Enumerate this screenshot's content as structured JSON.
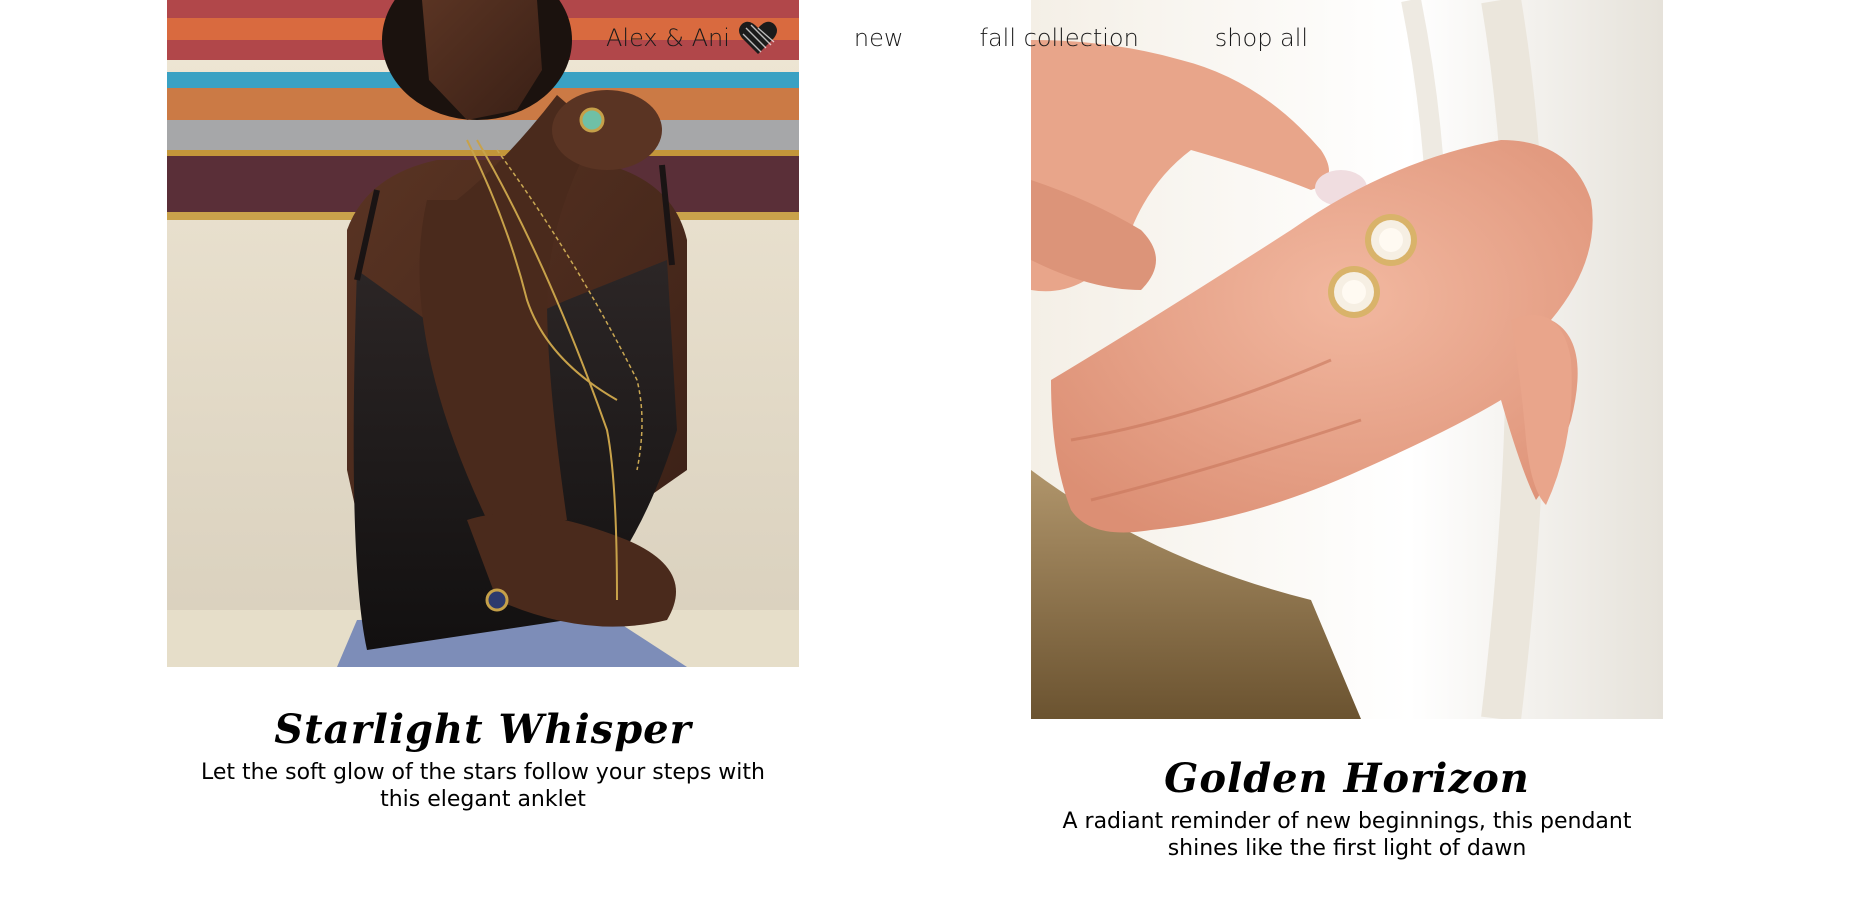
{
  "nav": {
    "brand": "Alex & Ani",
    "brand_icon": "heart-icon",
    "links": [
      "new",
      "fall collection",
      "shop all"
    ]
  },
  "products": [
    {
      "title": "Starlight Whisper",
      "description": "Let the soft glow of the stars follow your steps with this elegant anklet",
      "image": "woman-with-gold-necklaces-photo"
    },
    {
      "title": "Golden Horizon",
      "description": "A radiant reminder of new beginnings, this pendant shines like the first light of dawn",
      "image": "pearl-earrings-in-palm-photo"
    }
  ],
  "colors": {
    "background": "#ffffff",
    "text": "#000000"
  }
}
